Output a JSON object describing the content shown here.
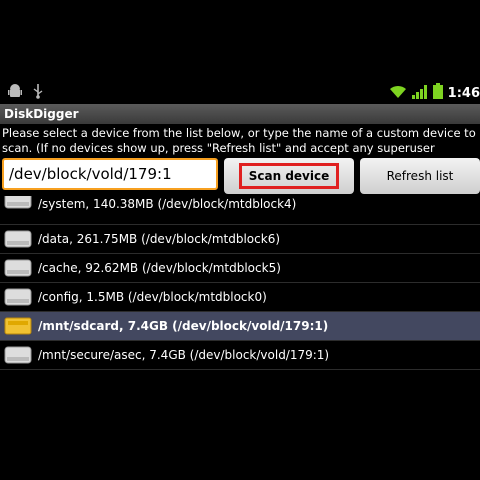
{
  "status_bar": {
    "time": "1:46"
  },
  "app": {
    "title": "DiskDigger"
  },
  "instructions": "Please select a device from the list below, or type the name of a custom device to scan. (If no devices show up, press \"Refresh list\" and accept any superuser requests)",
  "device_input": {
    "value": "/dev/block/vold/179:1"
  },
  "buttons": {
    "scan": "Scan device",
    "refresh": "Refresh list"
  },
  "devices": [
    {
      "label": "/system, 140.38MB (/dev/block/mtdblock4)",
      "icon": "drive-icon"
    },
    {
      "label": "/data, 261.75MB (/dev/block/mtdblock6)",
      "icon": "drive-icon"
    },
    {
      "label": "/cache, 92.62MB (/dev/block/mtdblock5)",
      "icon": "drive-icon"
    },
    {
      "label": "/config, 1.5MB (/dev/block/mtdblock0)",
      "icon": "drive-icon"
    },
    {
      "label": "/mnt/sdcard, 7.4GB (/dev/block/vold/179:1)",
      "icon": "sdcard-icon",
      "selected": true
    },
    {
      "label": "/mnt/secure/asec, 7.4GB (/dev/block/vold/179:1)",
      "icon": "drive-icon"
    }
  ],
  "colors": {
    "selected_row": "#434860",
    "highlight_border": "#e02020",
    "input_border": "#f7a020",
    "battery": "#7ed321",
    "wifi": "#7ed321"
  }
}
